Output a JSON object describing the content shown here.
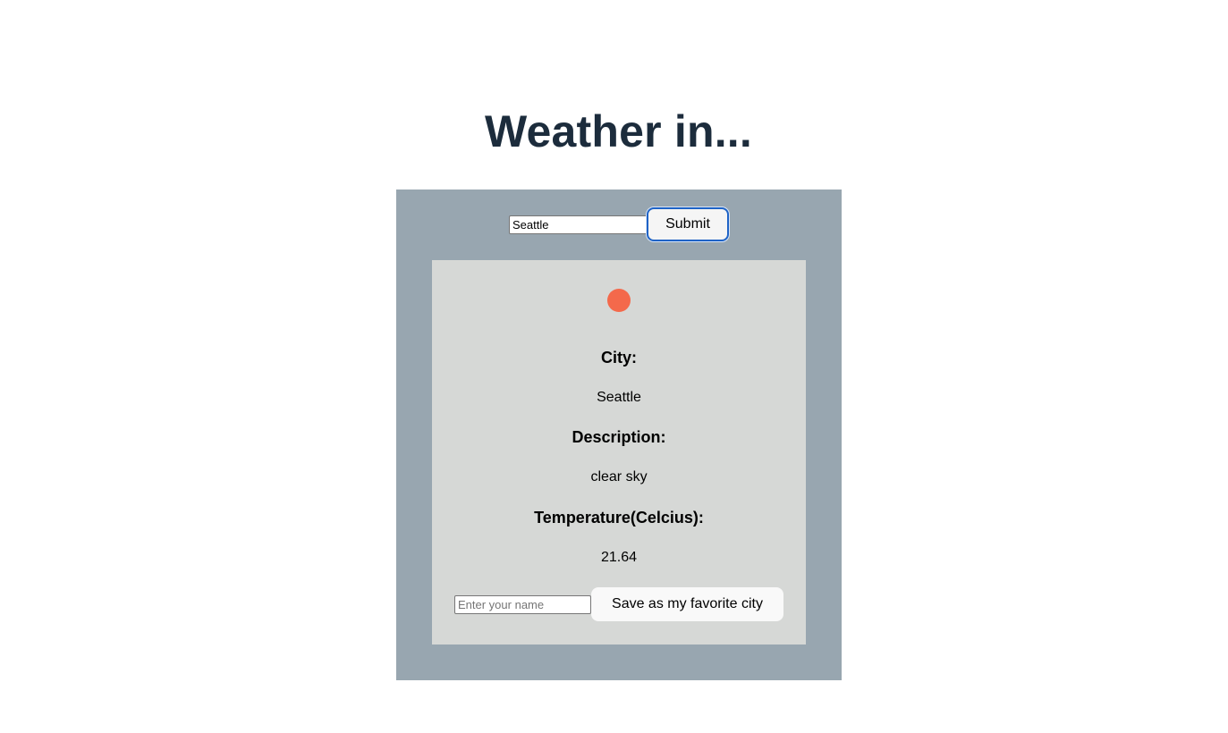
{
  "page": {
    "title": "Weather in..."
  },
  "search": {
    "city_value": "Seattle",
    "submit_label": "Submit"
  },
  "result": {
    "icon": "weather-status-icon",
    "icon_color": "#f4694b",
    "city_label": "City:",
    "city_value": "Seattle",
    "description_label": "Description:",
    "description_value": "clear sky",
    "temperature_label": "Temperature(Celcius):",
    "temperature_value": "21.64"
  },
  "favorite": {
    "name_placeholder": "Enter your name",
    "save_label": "Save as my favorite city"
  },
  "colors": {
    "title": "#1c2c3c",
    "outer_panel": "#98a6b0",
    "inner_card": "#d6d8d6",
    "submit_focus_border": "#1f63c6"
  }
}
